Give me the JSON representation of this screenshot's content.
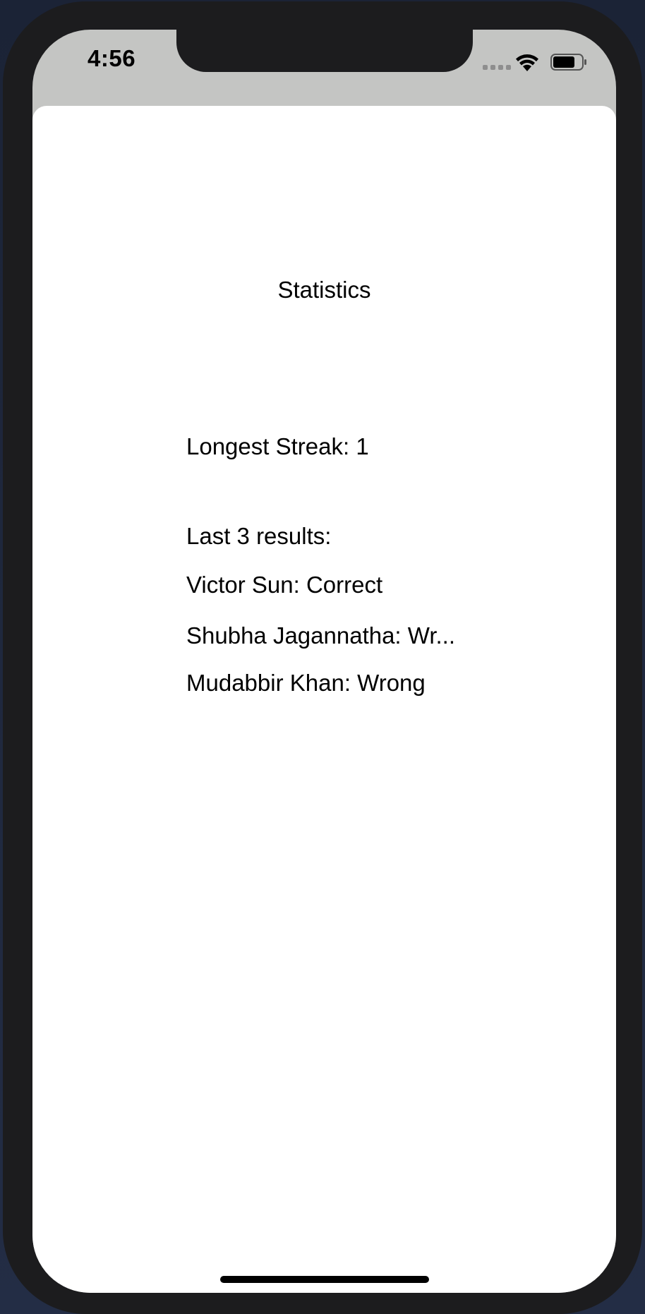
{
  "status_bar": {
    "time": "4:56"
  },
  "screen": {
    "title": "Statistics",
    "longest_streak": "Longest Streak: 1",
    "last_results_label": "Last 3 results:",
    "results": [
      "Victor Sun: Correct",
      "Shubha Jagannatha: Wr...",
      "Mudabbir Khan: Wrong"
    ]
  },
  "colors": {
    "frame": "#1c1c1e",
    "status_bar_bg": "#c4c5c3",
    "sheet_bg": "#ffffff",
    "text": "#000000"
  },
  "icons": [
    "cellular-signal-icon",
    "wifi-icon",
    "battery-icon"
  ]
}
